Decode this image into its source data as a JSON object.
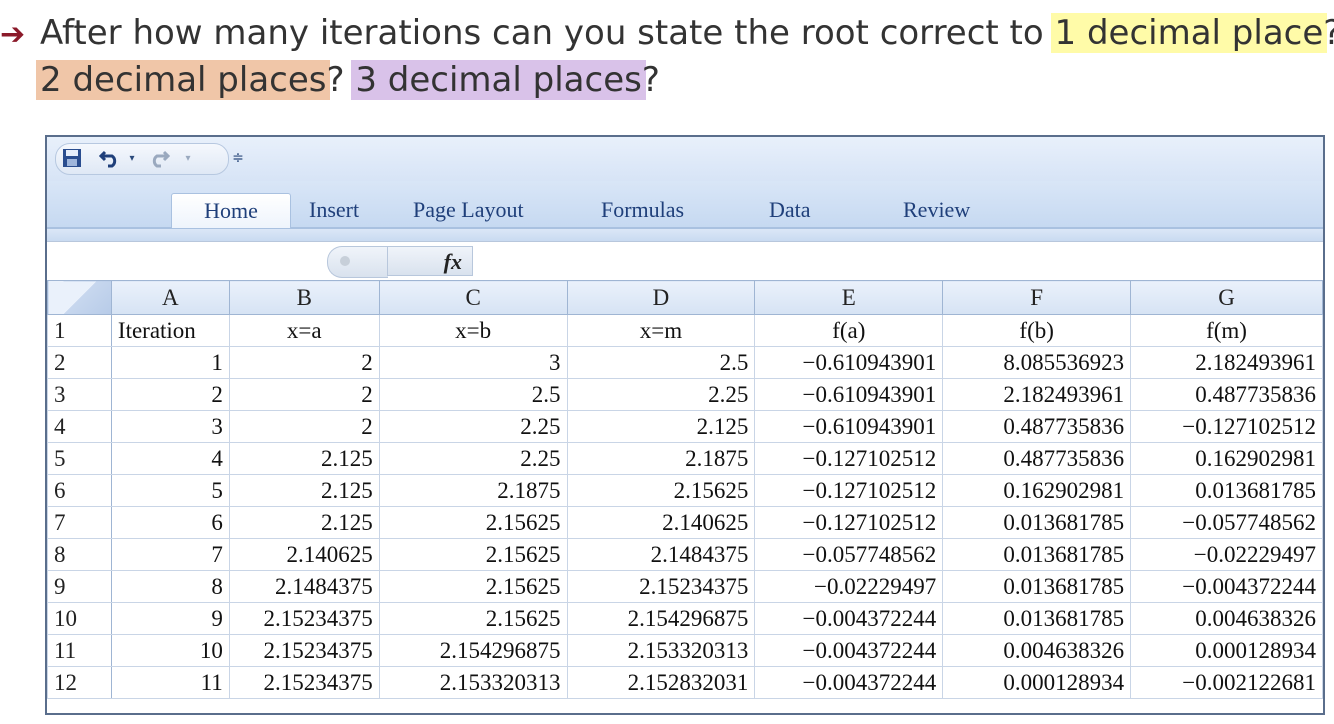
{
  "question": {
    "arrow": "➔",
    "line1_text": "After how many iterations can you state the root correct to ",
    "hl1": "1 decimal place",
    "hl1_color": "#fffba8",
    "q_mark": "?",
    "hl2": "2 decimal places",
    "hl2_color": "#f0c6a8",
    "hl3": "3 decimal places",
    "hl3_color": "#d9c2e9"
  },
  "excel": {
    "qat_icons": [
      "save-icon",
      "undo-icon",
      "redo-icon",
      "customize-icon"
    ],
    "tabs": [
      "Home",
      "Insert",
      "Page Layout",
      "Formulas",
      "Data",
      "Review"
    ],
    "active_tab": "Home",
    "fx_label": "fx",
    "formula_value": "",
    "columns": [
      "A",
      "B",
      "C",
      "D",
      "E",
      "F",
      "G"
    ],
    "rows": [
      {
        "n": "1",
        "cells": [
          "Iteration",
          "x=a",
          "x=b",
          "x=m",
          "f(a)",
          "f(b)",
          "f(m)"
        ]
      },
      {
        "n": "2",
        "cells": [
          "1",
          "2",
          "3",
          "2.5",
          "−0.610943901",
          "8.085536923",
          "2.182493961"
        ]
      },
      {
        "n": "3",
        "cells": [
          "2",
          "2",
          "2.5",
          "2.25",
          "−0.610943901",
          "2.182493961",
          "0.487735836"
        ]
      },
      {
        "n": "4",
        "cells": [
          "3",
          "2",
          "2.25",
          "2.125",
          "−0.610943901",
          "0.487735836",
          "−0.127102512"
        ]
      },
      {
        "n": "5",
        "cells": [
          "4",
          "2.125",
          "2.25",
          "2.1875",
          "−0.127102512",
          "0.487735836",
          "0.162902981"
        ]
      },
      {
        "n": "6",
        "cells": [
          "5",
          "2.125",
          "2.1875",
          "2.15625",
          "−0.127102512",
          "0.162902981",
          "0.013681785"
        ]
      },
      {
        "n": "7",
        "cells": [
          "6",
          "2.125",
          "2.15625",
          "2.140625",
          "−0.127102512",
          "0.013681785",
          "−0.057748562"
        ]
      },
      {
        "n": "8",
        "cells": [
          "7",
          "2.140625",
          "2.15625",
          "2.1484375",
          "−0.057748562",
          "0.013681785",
          "−0.02229497"
        ]
      },
      {
        "n": "9",
        "cells": [
          "8",
          "2.1484375",
          "2.15625",
          "2.15234375",
          "−0.02229497",
          "0.013681785",
          "−0.004372244"
        ]
      },
      {
        "n": "10",
        "cells": [
          "9",
          "2.15234375",
          "2.15625",
          "2.154296875",
          "−0.004372244",
          "0.013681785",
          "0.004638326"
        ]
      },
      {
        "n": "11",
        "cells": [
          "10",
          "2.15234375",
          "2.154296875",
          "2.153320313",
          "−0.004372244",
          "0.004638326",
          "0.000128934"
        ]
      },
      {
        "n": "12",
        "cells": [
          "11",
          "2.15234375",
          "2.153320313",
          "2.152832031",
          "−0.004372244",
          "0.000128934",
          "−0.002122681"
        ]
      }
    ]
  }
}
